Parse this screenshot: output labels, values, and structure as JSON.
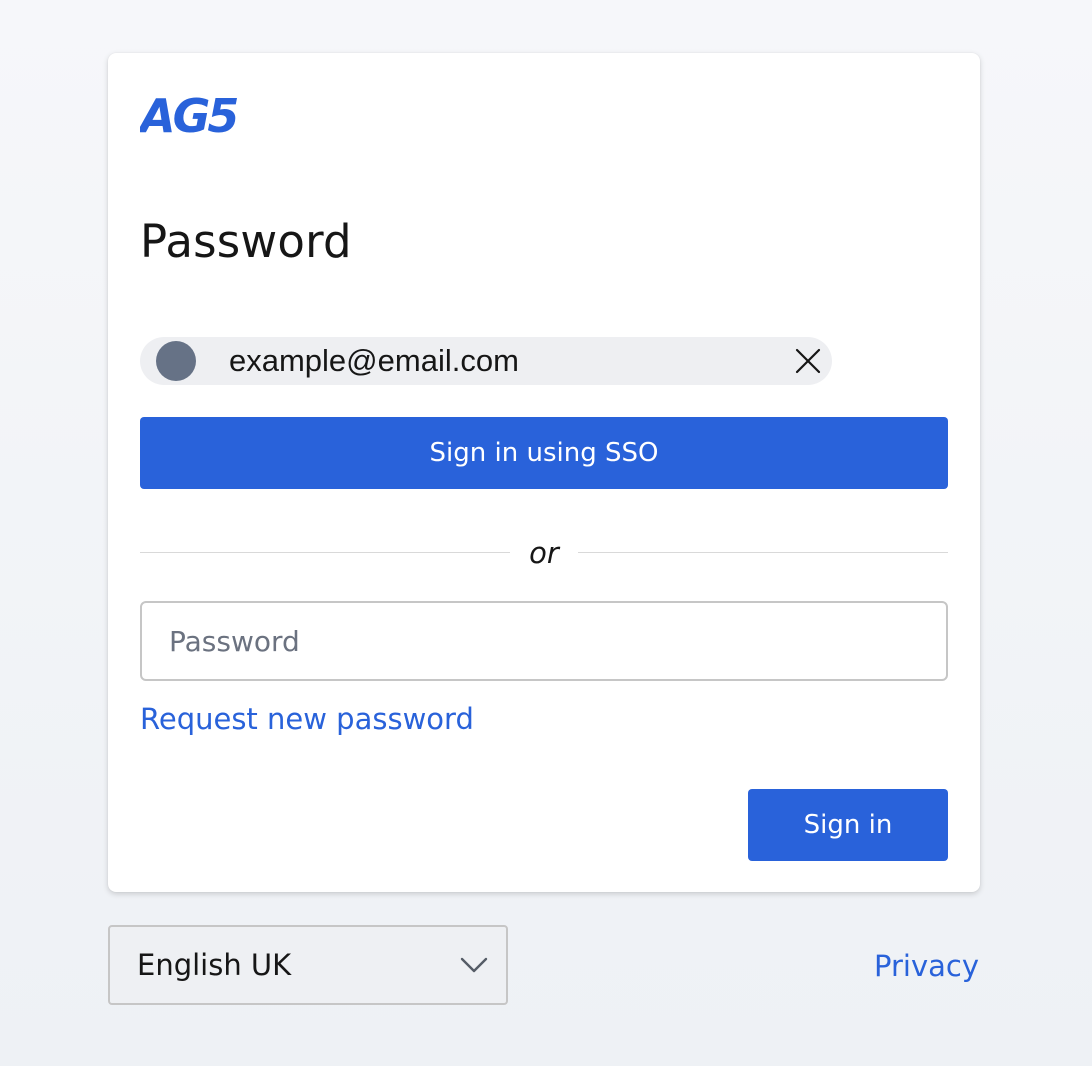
{
  "brand": {
    "logo_text": "AG5",
    "accent_color": "#2962da"
  },
  "login": {
    "title": "Password",
    "account_chip": {
      "email": "example@email.com",
      "avatar_icon": "user-avatar-icon",
      "remove_icon": "close-icon"
    },
    "sso_button_label": "Sign in using SSO",
    "divider_label": "or",
    "password_input": {
      "placeholder": "Password",
      "value": ""
    },
    "request_password_link": "Request new password",
    "sign_in_button_label": "Sign in"
  },
  "footer": {
    "language": {
      "selected": "English UK",
      "icon": "chevron-down-icon"
    },
    "privacy_link": "Privacy"
  }
}
